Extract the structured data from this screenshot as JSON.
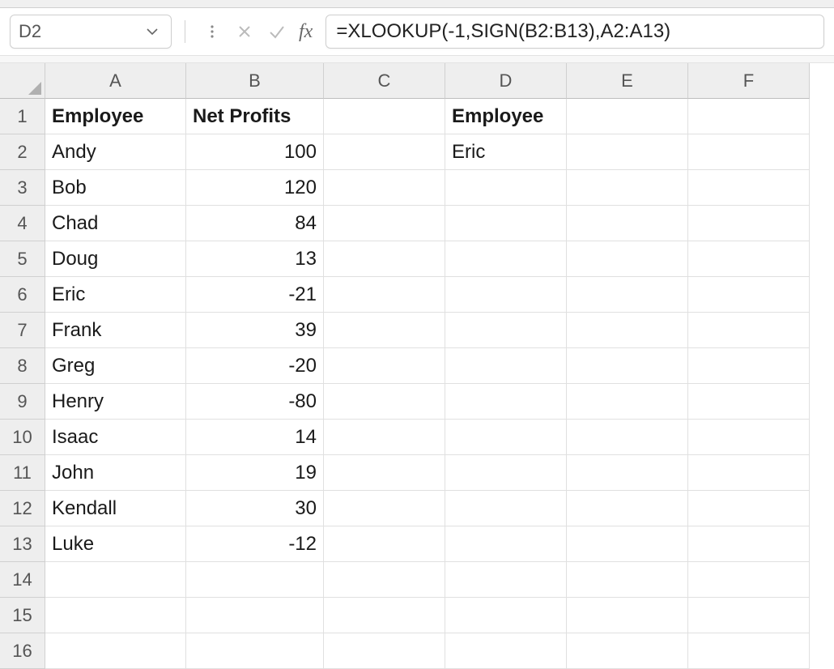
{
  "namebox": {
    "value": "D2"
  },
  "formula_bar": {
    "fx_label": "fx",
    "value": "=XLOOKUP(-1,SIGN(B2:B13),A2:A13)"
  },
  "columns": [
    "A",
    "B",
    "C",
    "D",
    "E",
    "F"
  ],
  "row_headers": [
    "1",
    "2",
    "3",
    "4",
    "5",
    "6",
    "7",
    "8",
    "9",
    "10",
    "11",
    "12",
    "13",
    "14",
    "15",
    "16"
  ],
  "cells": {
    "A1": "Employee",
    "B1": "Net Profits",
    "D1": "Employee",
    "A2": "Andy",
    "B2": "100",
    "D2": "Eric",
    "A3": "Bob",
    "B3": "120",
    "A4": "Chad",
    "B4": "84",
    "A5": "Doug",
    "B5": "13",
    "A6": "Eric",
    "B6": "-21",
    "A7": "Frank",
    "B7": "39",
    "A8": "Greg",
    "B8": "-20",
    "A9": "Henry",
    "B9": "-80",
    "A10": "Isaac",
    "B10": "14",
    "A11": "John",
    "B11": "19",
    "A12": "Kendall",
    "B12": "30",
    "A13": "Luke",
    "B13": "-12"
  },
  "chart_data": {
    "type": "table",
    "title": "Employee Net Profits with XLOOKUP first negative",
    "columns": [
      "Employee",
      "Net Profits"
    ],
    "rows": [
      [
        "Andy",
        100
      ],
      [
        "Bob",
        120
      ],
      [
        "Chad",
        84
      ],
      [
        "Doug",
        13
      ],
      [
        "Eric",
        -21
      ],
      [
        "Frank",
        39
      ],
      [
        "Greg",
        -20
      ],
      [
        "Henry",
        -80
      ],
      [
        "Isaac",
        14
      ],
      [
        "John",
        19
      ],
      [
        "Kendall",
        30
      ],
      [
        "Luke",
        -12
      ]
    ],
    "lookup_result": {
      "label": "Employee",
      "value": "Eric",
      "formula": "=XLOOKUP(-1,SIGN(B2:B13),A2:A13)"
    }
  }
}
